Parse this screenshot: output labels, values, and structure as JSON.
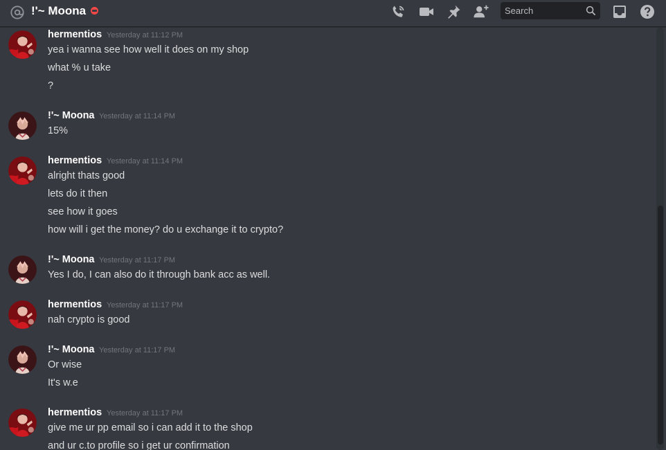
{
  "header": {
    "channel_name": "!'~ Moona",
    "status": "do-not-disturb",
    "search_placeholder": "Search",
    "icons": [
      "at-icon",
      "call-icon",
      "video-icon",
      "pin-icon",
      "add-member-icon",
      "search-icon",
      "inbox-icon",
      "help-icon"
    ]
  },
  "colors": {
    "background": "#36393f",
    "text": "#dcddde",
    "timestamp": "#72767d",
    "dnd": "#f04747",
    "search_bg": "#202225"
  },
  "messages": [
    {
      "author": "hermentios",
      "timestamp": "Yesterday at 11:12 PM",
      "avatar": "hermentios",
      "lines": [
        "yea i wanna see how well it does on my shop",
        "what % u take",
        "?"
      ]
    },
    {
      "author": "!'~ Moona",
      "timestamp": "Yesterday at 11:14 PM",
      "avatar": "moona",
      "lines": [
        "15%"
      ]
    },
    {
      "author": "hermentios",
      "timestamp": "Yesterday at 11:14 PM",
      "avatar": "hermentios",
      "lines": [
        "alright thats good",
        "lets do it then",
        "see how it goes",
        "how will i get the money? do u exchange it to crypto?"
      ]
    },
    {
      "author": "!'~ Moona",
      "timestamp": "Yesterday at 11:17 PM",
      "avatar": "moona",
      "lines": [
        "Yes I do, I can also do it through bank acc as well."
      ]
    },
    {
      "author": "hermentios",
      "timestamp": "Yesterday at 11:17 PM",
      "avatar": "hermentios",
      "lines": [
        "nah crypto is good"
      ]
    },
    {
      "author": "!'~ Moona",
      "timestamp": "Yesterday at 11:17 PM",
      "avatar": "moona",
      "lines": [
        "Or wise",
        "It's w.e"
      ]
    },
    {
      "author": "hermentios",
      "timestamp": "Yesterday at 11:17 PM",
      "avatar": "hermentios",
      "lines": [
        "give me ur pp email so i can add it to the shop",
        "and ur c.to profile so i get ur confirmation"
      ]
    }
  ]
}
